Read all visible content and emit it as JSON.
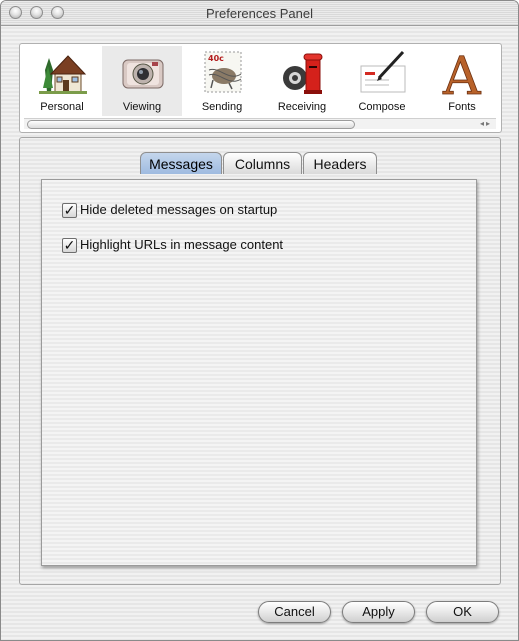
{
  "window": {
    "title": "Preferences Panel"
  },
  "toolbar": {
    "items": [
      {
        "label": "Personal",
        "icon": "house-icon"
      },
      {
        "label": "Viewing",
        "icon": "camera-icon",
        "selected": true
      },
      {
        "label": "Sending",
        "icon": "stamp-icon"
      },
      {
        "label": "Receiving",
        "icon": "mailbox-icon"
      },
      {
        "label": "Compose",
        "icon": "pen-icon"
      },
      {
        "label": "Fonts",
        "icon": "font-icon"
      }
    ]
  },
  "tabs": {
    "items": [
      {
        "label": "Messages",
        "active": true
      },
      {
        "label": "Columns"
      },
      {
        "label": "Headers"
      }
    ]
  },
  "messages": {
    "options": [
      {
        "label": "Hide deleted messages on startup",
        "checked": true
      },
      {
        "label": "Highlight URLs in message content",
        "checked": true
      }
    ]
  },
  "buttons": {
    "cancel": "Cancel",
    "apply": "Apply",
    "ok": "OK"
  },
  "check_mark": "✓"
}
